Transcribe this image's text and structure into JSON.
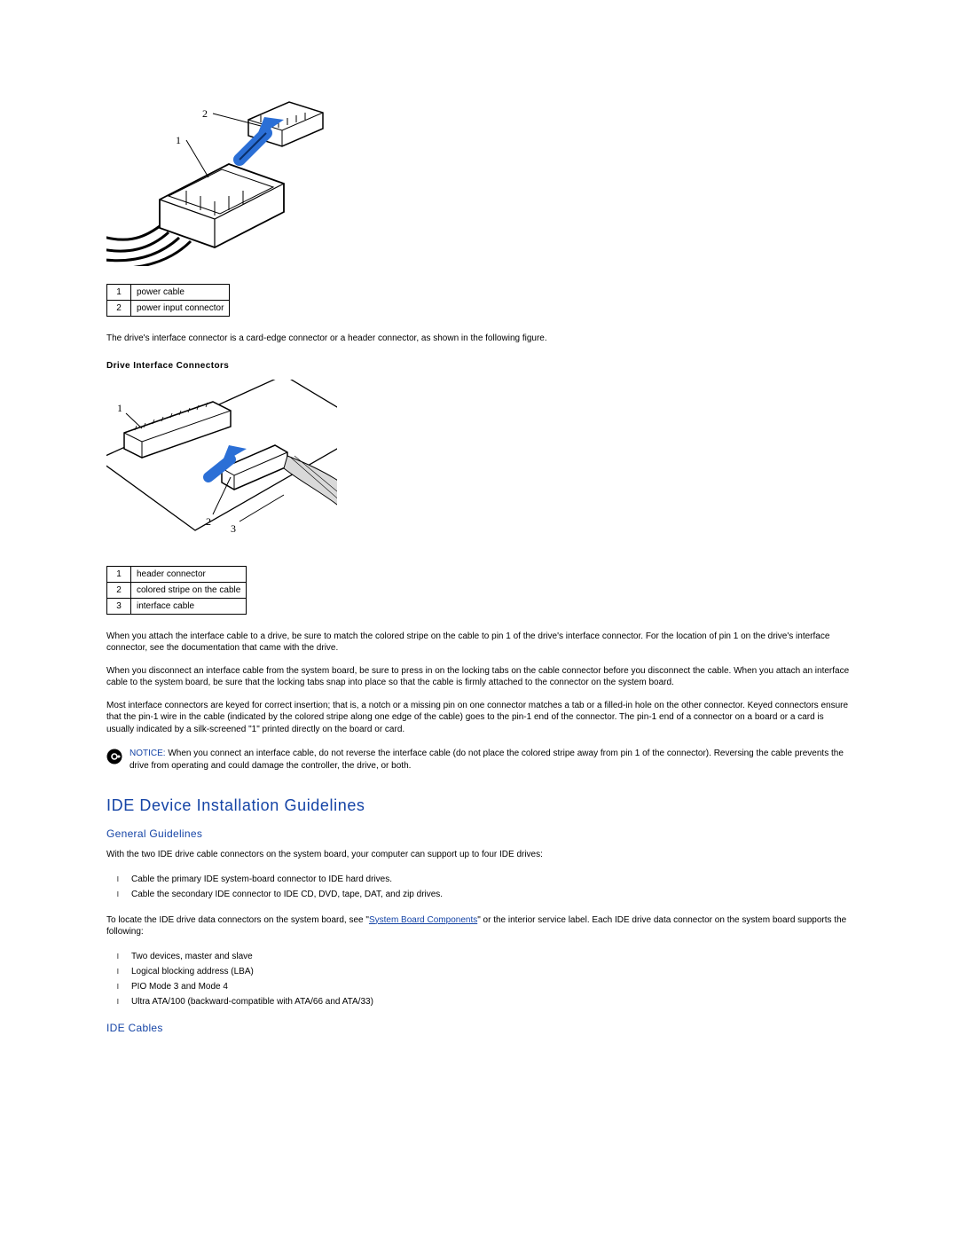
{
  "figure1": {
    "callouts": {
      "c1": "1",
      "c2": "2"
    }
  },
  "table1": {
    "r1n": "1",
    "r1t": "power cable",
    "r2n": "2",
    "r2t": "power input connector"
  },
  "para1": "The drive's interface connector is a card-edge connector or a header connector, as shown in the following figure.",
  "subhead1": "Drive Interface Connectors",
  "figure2": {
    "callouts": {
      "c1": "1",
      "c2": "2",
      "c3": "3"
    }
  },
  "table2": {
    "r1n": "1",
    "r1t": "header connector",
    "r2n": "2",
    "r2t": "colored stripe on the cable",
    "r3n": "3",
    "r3t": "interface cable"
  },
  "para2": "When you attach the interface cable to a drive, be sure to match the colored stripe on the cable to pin 1 of the drive's interface connector. For the location of pin 1 on the drive's interface connector, see the documentation that came with the drive.",
  "para3": "When you disconnect an interface cable from the system board, be sure to press in on the locking tabs on the cable connector before you disconnect the cable. When you attach an interface cable to the system board, be sure that the locking tabs snap into place so that the cable is firmly attached to the connector on the system board.",
  "para4": "Most interface connectors are keyed for correct insertion; that is, a notch or a missing pin on one connector matches a tab or a filled-in hole on the other connector. Keyed connectors ensure that the pin-1 wire in the cable (indicated by the colored stripe along one edge of the cable) goes to the pin-1 end of the connector. The pin-1 end of a connector on a board or a card is usually indicated by a silk-screened \"1\" printed directly on the board or card.",
  "notice": {
    "label": "NOTICE:",
    "text": " When you connect an interface cable, do not reverse the interface cable (do not place the colored stripe away from pin 1 of the connector). Reversing the cable prevents the drive from operating and could damage the controller, the drive, or both."
  },
  "h2": "IDE Device Installation Guidelines",
  "h3a": "General Guidelines",
  "para5": "With the two IDE drive cable connectors on the system board, your computer can support up to four IDE drives:",
  "list1": [
    "Cable the primary IDE system-board connector to IDE hard drives.",
    "Cable the secondary IDE connector to IDE CD, DVD, tape, DAT, and zip drives."
  ],
  "para6a": "To locate the IDE drive data connectors on the system board, see \"",
  "link1": "System Board Components",
  "para6b": "\" or the interior service label. Each IDE drive data connector on the system board supports the following:",
  "list2": [
    "Two devices, master and slave",
    "Logical blocking address (LBA)",
    "PIO Mode 3 and Mode 4",
    "Ultra ATA/100 (backward-compatible with ATA/66 and ATA/33)"
  ],
  "h3b": "IDE Cables"
}
